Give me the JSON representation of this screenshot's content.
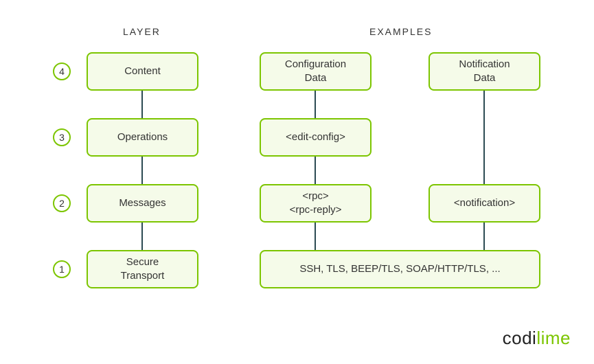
{
  "headers": {
    "layer": "LAYER",
    "examples": "EXAMPLES"
  },
  "rows": [
    {
      "num": "4",
      "layer": "Content"
    },
    {
      "num": "3",
      "layer": "Operations"
    },
    {
      "num": "2",
      "layer": "Messages"
    },
    {
      "num": "1",
      "layer": "Secure\nTransport"
    }
  ],
  "examples": {
    "content_left": "Configuration\nData",
    "content_right": "Notification\nData",
    "operations": "<edit-config>",
    "messages_left": "<rpc>\n<rpc-reply>",
    "messages_right": "<notification>",
    "transport": "SSH, TLS, BEEP/TLS, SOAP/HTTP/TLS, ..."
  },
  "logo": {
    "part1": "codi",
    "part2": "lime"
  },
  "colors": {
    "accent_green": "#7cc500",
    "box_bg": "#f5fbe9",
    "line": "#2b4a52"
  }
}
